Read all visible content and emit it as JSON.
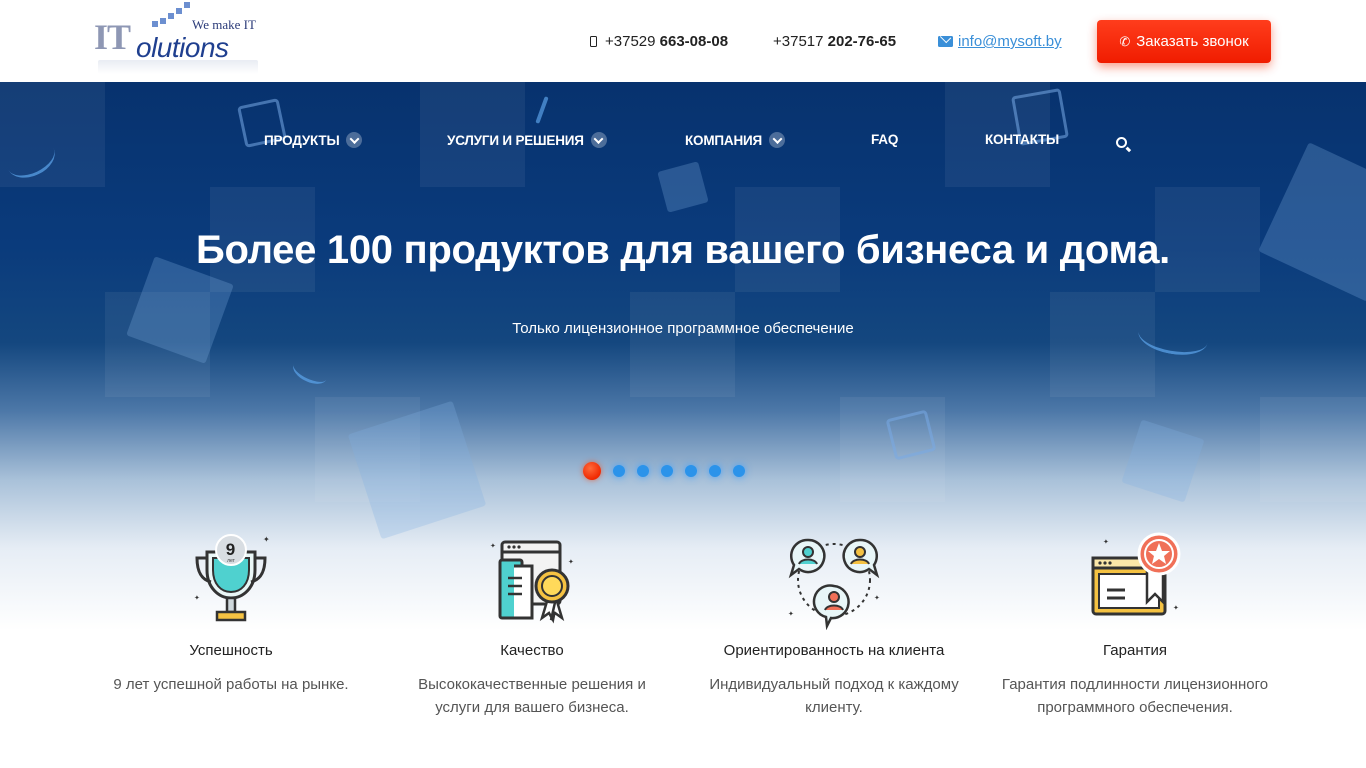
{
  "logo": {
    "tagline": "We make IT",
    "it": "IT",
    "solutions": "olutions"
  },
  "header": {
    "phone1_prefix": "+37529",
    "phone1_number": "663-08-08",
    "phone2_prefix": "+37517",
    "phone2_number": "202-76-65",
    "email": "info@mysoft.by",
    "call_button": "Заказать звонок"
  },
  "nav": {
    "items": [
      {
        "label": "ПРОДУКТЫ",
        "dropdown": true
      },
      {
        "label": "УСЛУГИ И РЕШЕНИЯ",
        "dropdown": true
      },
      {
        "label": "КОМПАНИЯ",
        "dropdown": true
      },
      {
        "label": "FAQ",
        "dropdown": false
      },
      {
        "label": "КОНТАКТЫ",
        "dropdown": false
      }
    ]
  },
  "hero": {
    "title": "Более 100 продуктов для вашего бизнеса и дома.",
    "subtitle": "Только лицензионное программное обеспечение",
    "slide_count": 7,
    "active_slide": 1
  },
  "features": [
    {
      "icon": "trophy-icon",
      "badge": "9",
      "badge_sub": "лет",
      "title": "Успешность",
      "line1": "9 лет успешной работы на рынке.",
      "line2": ""
    },
    {
      "icon": "quality-certificate-icon",
      "title": "Качество",
      "line1": "Высококачественные решения и",
      "line2": "услуги для вашего бизнеса."
    },
    {
      "icon": "client-focus-icon",
      "title": "Ориентированность на клиента",
      "line1": "Индивидуальный подход к каждому",
      "line2": "клиенту."
    },
    {
      "icon": "guarantee-badge-icon",
      "title": "Гарантия",
      "line1": "Гарантия подлинности лицензионного",
      "line2": "программного обеспечения."
    }
  ],
  "colors": {
    "accent_red": "#f01c00",
    "hero_blue": "#07326e",
    "link_blue": "#3a8fd8",
    "dot_blue": "#2b93ea"
  }
}
